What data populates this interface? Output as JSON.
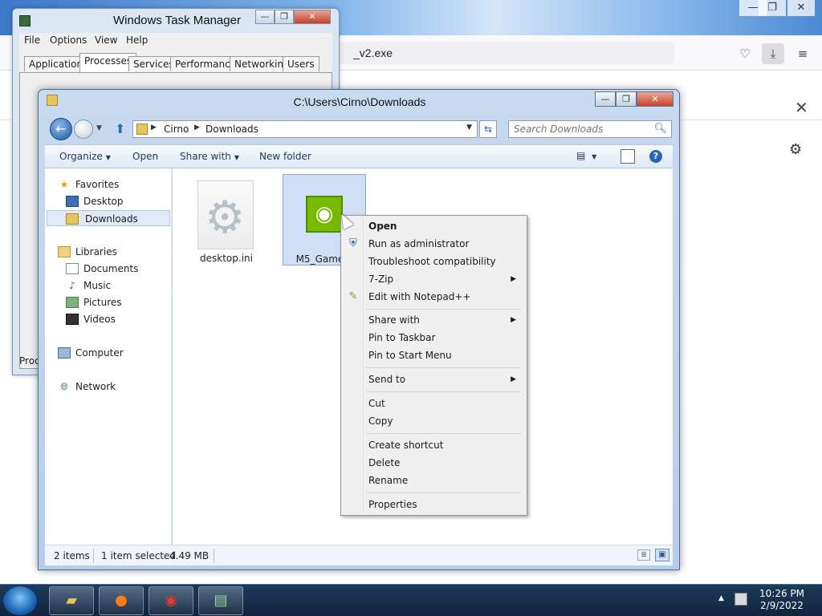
{
  "firefox": {
    "url_text": "_v2.exe",
    "window_buttons": [
      "—",
      "❐",
      "✕"
    ],
    "close_glyph": "✕"
  },
  "taskmgr": {
    "title": "Windows Task Manager",
    "menu": [
      "File",
      "Options",
      "View",
      "Help"
    ],
    "tabs": [
      "Applications",
      "Processes",
      "Services",
      "Performance",
      "Networking",
      "Users"
    ],
    "active_tab": "Processes",
    "status_text": "Proc"
  },
  "explorer": {
    "title": "C:\\Users\\Cirno\\Downloads",
    "breadcrumb": [
      "Cirno",
      "Downloads"
    ],
    "search_placeholder": "Search Downloads",
    "toolbar": {
      "organize": "Organize",
      "open": "Open",
      "share_with": "Share with",
      "new_folder": "New folder"
    },
    "nav": {
      "favorites": "Favorites",
      "desktop": "Desktop",
      "downloads": "Downloads",
      "libraries": "Libraries",
      "documents": "Documents",
      "music": "Music",
      "pictures": "Pictures",
      "videos": "Videos",
      "computer": "Computer",
      "network": "Network"
    },
    "files": [
      {
        "name": "desktop.ini",
        "icon": "gear-file-icon",
        "selected": false
      },
      {
        "name": "M5_Game_v2.exe",
        "display_name": "M5_Game_v",
        "icon": "nvidia-icon",
        "selected": true
      }
    ],
    "status": {
      "items": "2 items",
      "selected": "1 item selected",
      "size": "4.49 MB"
    }
  },
  "context_menu": {
    "items": [
      {
        "label": "Open",
        "bold": true
      },
      {
        "label": "Run as administrator",
        "icon": "shield-icon"
      },
      {
        "label": "Troubleshoot compatibility"
      },
      {
        "label": "7-Zip",
        "submenu": true
      },
      {
        "label": "Edit with Notepad++",
        "icon": "notepad-icon"
      },
      {
        "label": "Share with",
        "submenu": true
      },
      {
        "label": "Pin to Taskbar"
      },
      {
        "label": "Pin to Start Menu"
      },
      {
        "label": "Send to",
        "submenu": true
      },
      {
        "label": "Cut"
      },
      {
        "label": "Copy"
      },
      {
        "label": "Create shortcut"
      },
      {
        "label": "Delete"
      },
      {
        "label": "Rename"
      },
      {
        "label": "Properties"
      }
    ]
  },
  "taskbar": {
    "time": "10:26 PM",
    "date": "2/9/2022",
    "pinned": [
      "explorer-icon",
      "firefox-icon",
      "chrome-icon",
      "taskmgr-icon"
    ]
  },
  "colors": {
    "nvidia_green": "#76b900",
    "selection_blue": "#cfe0f6",
    "firefox_accent": "#0a84ff"
  }
}
